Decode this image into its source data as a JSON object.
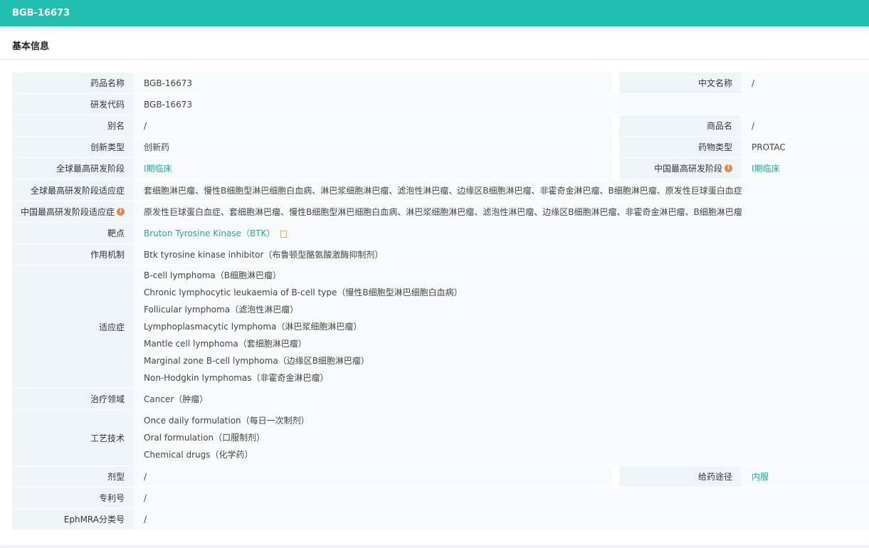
{
  "header": {
    "title": "BGB-16673"
  },
  "section": {
    "title": "基本信息"
  },
  "fields": {
    "drug_name": {
      "label": "药品名称",
      "value": "BGB-16673"
    },
    "chinese_name": {
      "label": "中文名称",
      "value": "/"
    },
    "dev_code": {
      "label": "研发代码",
      "value": "BGB-16673"
    },
    "alias": {
      "label": "别名",
      "value": "/"
    },
    "trade_name": {
      "label": "商品名",
      "value": "/"
    },
    "innovation_type": {
      "label": "创新类型",
      "value": "创新药"
    },
    "drug_type": {
      "label": "药物类型",
      "value": "PROTAC"
    },
    "global_phase": {
      "label": "全球最高研发阶段",
      "value": "Ⅰ期临床"
    },
    "china_phase": {
      "label": "中国最高研发阶段",
      "value": "Ⅰ期临床"
    },
    "global_indication": {
      "label": "全球最高研发阶段适应症",
      "value": "套细胞淋巴瘤、慢性B细胞型淋巴细胞白血病、淋巴浆细胞淋巴瘤、滤泡性淋巴瘤、边缘区B细胞淋巴瘤、非霍奇金淋巴瘤、B细胞淋巴瘤、原发性巨球蛋白血症"
    },
    "china_indication": {
      "label": "中国最高研发阶段适应症",
      "value": "原发性巨球蛋白血症、套细胞淋巴瘤、慢性B细胞型淋巴细胞白血病、淋巴浆细胞淋巴瘤、滤泡性淋巴瘤、边缘区B细胞淋巴瘤、非霍奇金淋巴瘤、B细胞淋巴瘤"
    },
    "target": {
      "label": "靶点",
      "value": "Bruton Tyrosine Kinase（BTK）"
    },
    "mechanism": {
      "label": "作用机制",
      "value": "Btk tyrosine kinase inhibitor（布鲁顿型酪氨酸激酶抑制剂）"
    },
    "indications": {
      "label": "适应症",
      "items": [
        "B-cell lymphoma（B细胞淋巴瘤）",
        "Chronic lymphocytic leukaemia of B-cell type（慢性B细胞型淋巴细胞白血病）",
        "Follicular lymphoma（滤泡性淋巴瘤）",
        "Lymphoplasmacytic lymphoma（淋巴浆细胞淋巴瘤）",
        "Mantle cell lymphoma（套细胞淋巴瘤）",
        "Marginal zone B-cell lymphoma（边缘区B细胞淋巴瘤）",
        "Non-Hodgkin lymphomas（非霍奇金淋巴瘤）"
      ]
    },
    "therapeutic_area": {
      "label": "治疗领域",
      "value": "Cancer（肿瘤）"
    },
    "technology": {
      "label": "工艺技术",
      "items": [
        "Once daily formulation（每日一次制剂）",
        "Oral formulation（口服制剂）",
        "Chemical drugs（化学药）"
      ]
    },
    "dosage_form": {
      "label": "剂型",
      "value": "/"
    },
    "route": {
      "label": "给药途径",
      "value": "内服"
    },
    "patent": {
      "label": "专利号",
      "value": "/"
    },
    "ephmra": {
      "label": "EphMRA分类号",
      "value": "/"
    }
  },
  "colors": {
    "accent": "#21bfaf",
    "link": "#21a99b",
    "info_icon": "#e0884e"
  },
  "icons": {
    "info": "info-icon",
    "note": "note-icon"
  }
}
